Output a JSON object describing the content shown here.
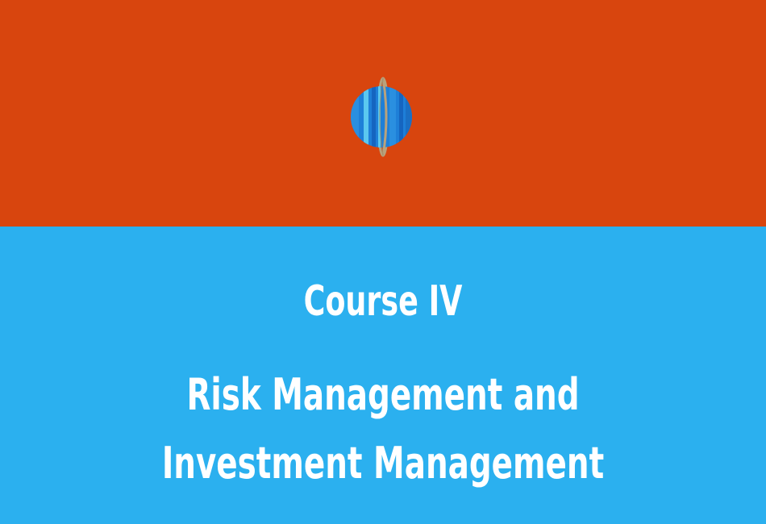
{
  "slide": {
    "course_label": "Course IV",
    "subject_line_1": "Risk Management and",
    "subject_line_2": "Investment Management",
    "planet_icon": "uranus-planet-icon"
  },
  "colors": {
    "top_band": "#D8450E",
    "bottom_band": "#2BB0EF",
    "title_text": "#FFFFFF",
    "planet_body": "#1E7FD8",
    "planet_stripes": "#5BC8F0",
    "planet_ring": "#B9A27C"
  }
}
